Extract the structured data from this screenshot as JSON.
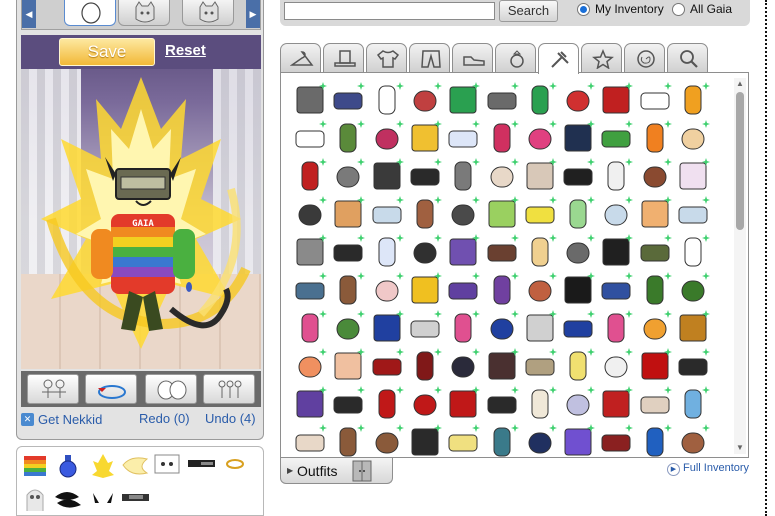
{
  "avatar_panel": {
    "save_label": "Save",
    "reset_label": "Reset",
    "carousel_slots": [
      "avatar-pose-front",
      "cat-head",
      "cat-head-alt"
    ],
    "action_buttons": [
      "pose-pair-icon",
      "rotate-icon",
      "head-swap-icon",
      "group-pose-icon"
    ],
    "get_nekkid_label": "Get Nekkid",
    "redo_label": "Redo (0)",
    "undo_label": "Undo (4)",
    "shirt_text": "GAIA"
  },
  "worn_items": [
    "rainbow-sweater",
    "blue-potion",
    "yellow-aura",
    "angel-wings",
    "white-mask",
    "black-visor",
    "gold-ring",
    "ghost-mask",
    "black-claws",
    "horn-tips",
    "dark-headband"
  ],
  "search": {
    "placeholder": "",
    "button_label": "Search",
    "scope_options": [
      "My Inventory",
      "All Gaia"
    ],
    "selected_scope": "My Inventory"
  },
  "tabs": [
    {
      "name": "hanger",
      "active": false
    },
    {
      "name": "hat",
      "active": false
    },
    {
      "name": "shirt",
      "active": false
    },
    {
      "name": "pants",
      "active": false
    },
    {
      "name": "shoes",
      "active": false
    },
    {
      "name": "ring",
      "active": false
    },
    {
      "name": "tools",
      "active": true
    },
    {
      "name": "star",
      "active": false
    },
    {
      "name": "spiral",
      "active": false
    },
    {
      "name": "search",
      "active": false
    }
  ],
  "inventory_grid": {
    "columns": 10,
    "rows": [
      [
        "#6a6a6a",
        "#3e4a8a",
        "#ffffff",
        "#c04040",
        "#2aa050",
        "#6a6a6a",
        "#2aa050",
        "#d03030",
        "#c02020",
        "#ffffff",
        "#f0a020"
      ],
      [
        "#ffffff",
        "#5a8a3a",
        "#c03060",
        "#f0c030",
        "#dde6f8",
        "#d03060",
        "#e04080",
        "#203050",
        "#40a040",
        "#f08020",
        "#f0d0a0"
      ],
      [
        "#c02020",
        "#7a7a7a",
        "#3a3a3a",
        "#2a2a2a",
        "#7a7a7a",
        "#e8d8c8",
        "#d8c8b8",
        "#202020",
        "#f0f0f0",
        "#8a4a30",
        "#f0e0f0"
      ],
      [
        "#3a3a3a",
        "#e0a060",
        "#c8daea",
        "#a06040",
        "#4a4a4a",
        "#9ad060",
        "#f0e040",
        "#9ad890",
        "#c8daea",
        "#f0b070",
        "#c8daea"
      ],
      [
        "#8a8a8a",
        "#2a2a2a",
        "#dde6f8",
        "#303030",
        "#7050b0",
        "#6a4030",
        "#f0d090",
        "#6a6a6a",
        "#202020",
        "#5a6a3a",
        "#ffffff"
      ],
      [
        "#4a7090",
        "#8a5a3a",
        "#f0c8c8",
        "#f0c020",
        "#6040a0",
        "#7040a0",
        "#c06040",
        "#1a1a1a",
        "#3050a0",
        "#3a7a2a",
        "#3a7a2a"
      ],
      [
        "#e05090",
        "#4a8a3a",
        "#2040a0",
        "#d0d0d0",
        "#e05090",
        "#2040a0",
        "#d0d0d0",
        "#2040a0",
        "#e05090",
        "#f0a030",
        "#c08020"
      ],
      [
        "#f09060",
        "#f0c0a0",
        "#a01818",
        "#801818",
        "#2a2a3a",
        "#4a3030",
        "#b0a080",
        "#f0e070",
        "#f0f0f0",
        "#c01010",
        "#2a2a2a"
      ],
      [
        "#6040a0",
        "#2a2a2a",
        "#c01818",
        "#c01818",
        "#c01818",
        "#2a2a2a",
        "#f0e8d8",
        "#c0c0e0",
        "#c02020",
        "#e0d0c0",
        "#70b0e0"
      ],
      [
        "#e8d8c8",
        "#8a5a3a",
        "#8a5a3a",
        "#2a2a2a",
        "#f0e080",
        "#3a7a8a",
        "#203060",
        "#7050d0",
        "#8a2020",
        "#2060c0",
        "#a06040"
      ]
    ]
  },
  "outfits_label": "Outfits",
  "full_inventory_label": "Full Inventory"
}
